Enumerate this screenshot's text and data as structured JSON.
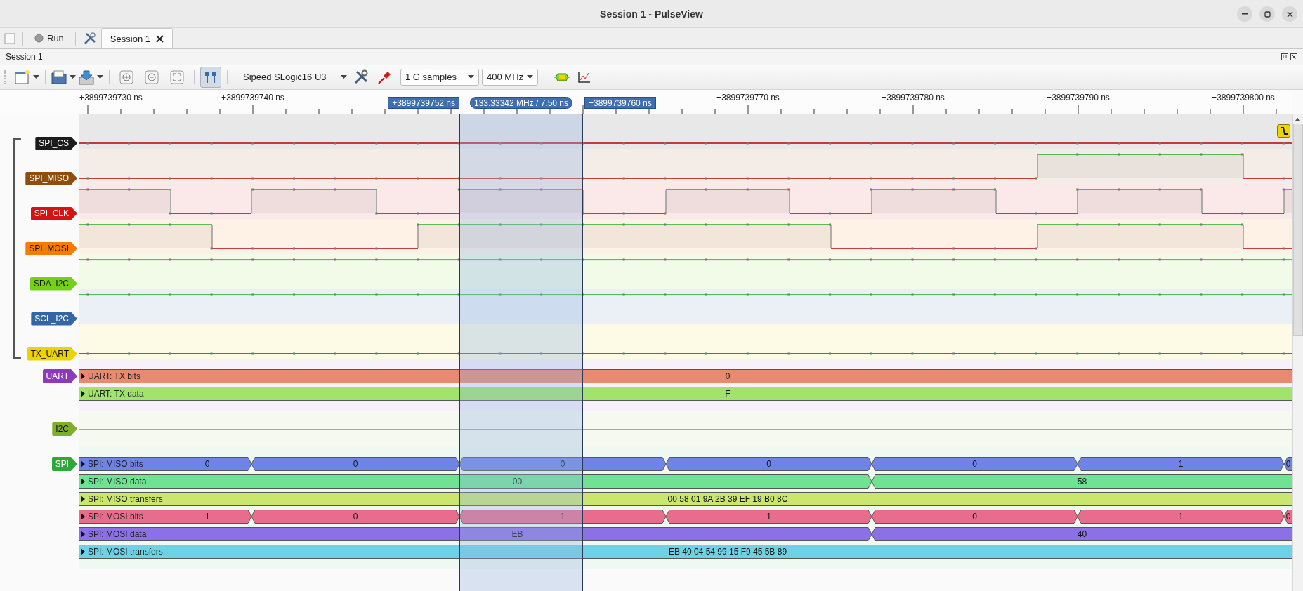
{
  "window": {
    "title": "Session 1 - PulseView"
  },
  "main_bar": {
    "run_button": "Run",
    "tabs": [
      {
        "label": "Session 1",
        "selected": true
      }
    ]
  },
  "session": {
    "title": "Session 1"
  },
  "toolbar": {
    "device": "Sipeed SLogic16 U3",
    "sample_count": "1 G samples",
    "sample_rate": "400 MHz",
    "cursors_on": true
  },
  "ruler": {
    "ticks": [
      "+3899739730 ns",
      "+3899739740 ns",
      "+3899739770 ns",
      "+3899739780 ns",
      "+3899739790 ns",
      "+3899739800 ns"
    ]
  },
  "cursors": {
    "start": "+3899739752 ns",
    "span": "133.33342 MHz / 7.50 ns",
    "end": "+3899739760 ns"
  },
  "signals": [
    {
      "name": "SPI_CS",
      "color": "#1c1c1c"
    },
    {
      "name": "SPI_MISO",
      "color": "#8f4e0c"
    },
    {
      "name": "SPI_CLK",
      "color": "#d41414"
    },
    {
      "name": "SPI_MOSI",
      "color": "#f57c00"
    },
    {
      "name": "SDA_I2C",
      "color": "#73d216"
    },
    {
      "name": "SCL_I2C",
      "color": "#3465a4"
    },
    {
      "name": "TX_UART",
      "color": "#edd400"
    }
  ],
  "decoders": [
    {
      "name": "UART",
      "color": "#8e3ab8",
      "rows": [
        {
          "label": "UART: TX bits",
          "kind": "whole",
          "color": "#e88a6e",
          "segments": [
            "0"
          ]
        },
        {
          "label": "UART: TX data",
          "kind": "whole",
          "color": "#a0e46c",
          "segments": [
            "F"
          ]
        }
      ]
    },
    {
      "name": "I2C",
      "color": "#7fae2c"
    },
    {
      "name": "SPI",
      "color": "#2ea83a",
      "rows": [
        {
          "label": "SPI: MISO bits",
          "kind": "bits",
          "color": "#6e84e6",
          "segments": [
            "0",
            "0",
            "0",
            "0",
            "0",
            "1",
            "0"
          ]
        },
        {
          "label": "SPI: MISO data",
          "kind": "bytes",
          "color": "#6ee492",
          "segments": [
            "00",
            "58"
          ]
        },
        {
          "label": "SPI: MISO transfers",
          "kind": "whole",
          "color": "#cbe66e",
          "segments": [
            "00 58 01 9A 2B 39 EF 19 B0 8C"
          ]
        },
        {
          "label": "SPI: MOSI bits",
          "kind": "bits",
          "color": "#e86c8c",
          "segments": [
            "1",
            "0",
            "1",
            "1",
            "0",
            "1",
            "0"
          ]
        },
        {
          "label": "SPI: MOSI data",
          "kind": "bytes",
          "color": "#8c70e6",
          "segments": [
            "EB",
            "40"
          ]
        },
        {
          "label": "SPI: MOSI transfers",
          "kind": "whole",
          "color": "#6dd2e6",
          "segments": [
            "EB 40 04 54 99 15 F9 45 5B 89"
          ]
        }
      ]
    }
  ]
}
